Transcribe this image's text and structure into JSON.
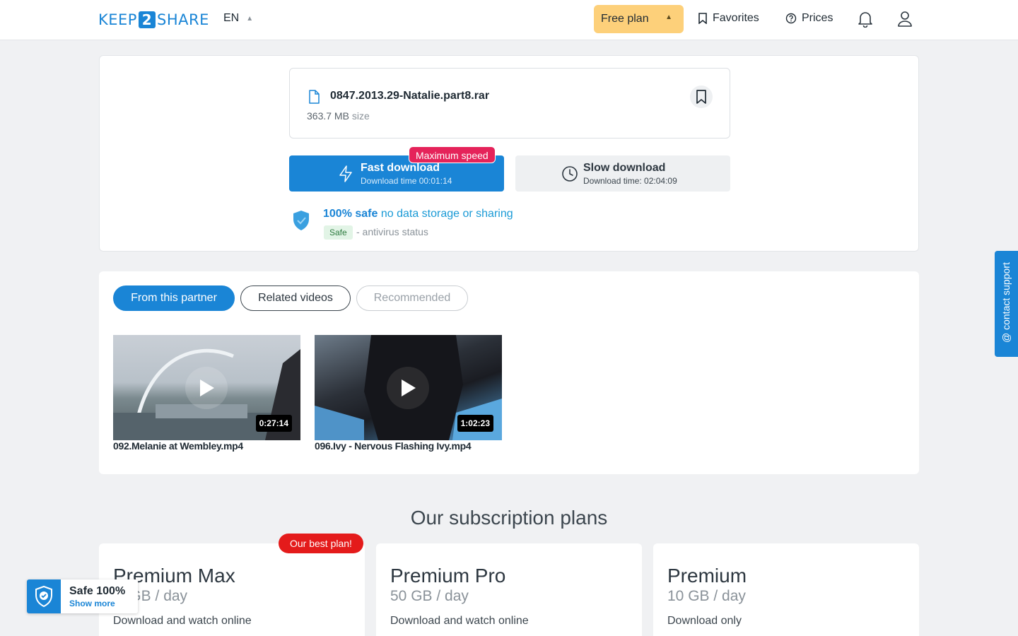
{
  "header": {
    "logo_left": "KEEP",
    "logo_mid": "2",
    "logo_right": "SHARE",
    "language": "EN",
    "plan_button": "Free plan",
    "favorites": "Favorites",
    "prices": "Prices"
  },
  "file": {
    "name": "0847.2013.29-Natalie.part8.rar",
    "size_value": "363.7 MB",
    "size_unit": "size"
  },
  "download": {
    "fast_title": "Fast download",
    "fast_sub": "Download time 00:01:14",
    "max_badge": "Maximum speed",
    "slow_title": "Slow download",
    "slow_sub": "Download time: 02:04:09"
  },
  "safety": {
    "strong": "100% safe",
    "rest": "no data storage or sharing",
    "pill": "Safe",
    "status": "- antivirus status"
  },
  "tabs": {
    "partner": "From this partner",
    "related": "Related videos",
    "recommended": "Recommended"
  },
  "videos": [
    {
      "title": "092.Melanie at Wembley.mp4",
      "duration": "0:27:14"
    },
    {
      "title": "096.Ivy - Nervous Flashing Ivy.mp4",
      "duration": "1:02:23"
    }
  ],
  "plans": {
    "heading": "Our subscription plans",
    "best_badge": "Our best plan!",
    "items": [
      {
        "name": "Premium Max",
        "quota": "GB / day",
        "desc": "Download and watch online"
      },
      {
        "name": "Premium Pro",
        "quota": "50 GB / day",
        "desc": "Download and watch online"
      },
      {
        "name": "Premium",
        "quota": "10 GB / day",
        "desc": "Download only"
      }
    ]
  },
  "support": {
    "label": "contact support"
  },
  "safe_widget": {
    "title": "Safe 100%",
    "link": "Show more"
  },
  "colors": {
    "primary": "#1a85d6",
    "accent_red": "#e5235a",
    "plan_yellow": "#fdd07a"
  }
}
